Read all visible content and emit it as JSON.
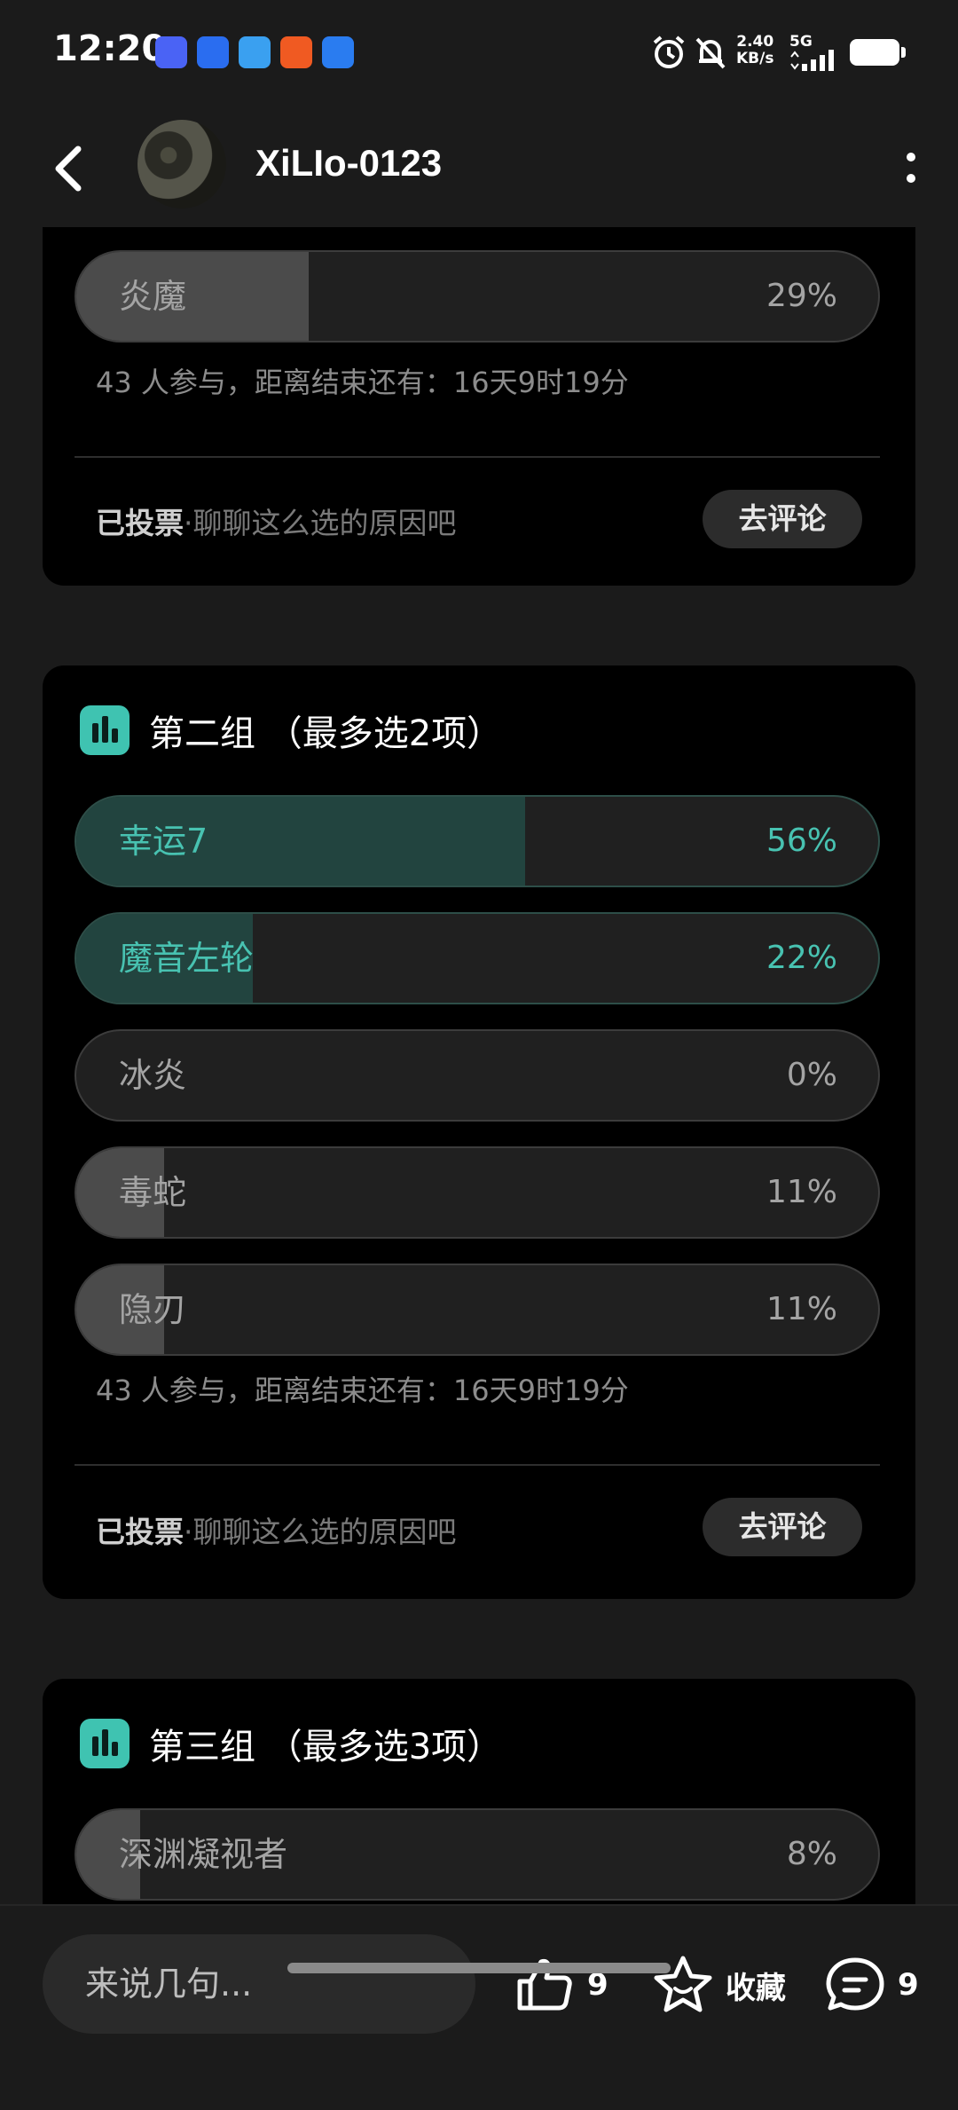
{
  "status_bar": {
    "time": "12:20",
    "net_speed_value": "2.40",
    "net_speed_unit": "KB/s",
    "network": "5G",
    "notif_icons": [
      {
        "name": "vivo-app-icon",
        "color": "#4a63f5"
      },
      {
        "name": "browser-app-icon",
        "color": "#2a6df0"
      },
      {
        "name": "cloud-app-icon",
        "color": "#3aa0f0"
      },
      {
        "name": "taobao-app-icon",
        "color": "#f05a22"
      },
      {
        "name": "message-app-icon",
        "color": "#2a7cf0"
      }
    ]
  },
  "header": {
    "username": "XiLIo-0123"
  },
  "cards": [
    {
      "title": "",
      "options": [
        {
          "label": "炎魔",
          "percent": "29%",
          "fill": 0.29,
          "selected": false
        }
      ],
      "meta": "43 人参与，距离结束还有：16天9时19分",
      "voted_label": "已投票",
      "voted_hint": "·聊聊这么选的原因吧",
      "comment_button": "去评论"
    },
    {
      "title": "第二组 （最多选2项）",
      "options": [
        {
          "label": "幸运7",
          "percent": "56%",
          "fill": 0.56,
          "selected": true
        },
        {
          "label": "魔音左轮",
          "percent": "22%",
          "fill": 0.22,
          "selected": true
        },
        {
          "label": "冰炎",
          "percent": "0%",
          "fill": 0.0,
          "selected": false
        },
        {
          "label": "毒蛇",
          "percent": "11%",
          "fill": 0.11,
          "selected": false
        },
        {
          "label": "隐刃",
          "percent": "11%",
          "fill": 0.11,
          "selected": false
        }
      ],
      "meta": "43 人参与，距离结束还有：16天9时19分",
      "voted_label": "已投票",
      "voted_hint": "·聊聊这么选的原因吧",
      "comment_button": "去评论"
    },
    {
      "title": "第三组 （最多选3项）",
      "options": [
        {
          "label": "深渊凝视者",
          "percent": "8%",
          "fill": 0.08,
          "selected": false
        }
      ]
    }
  ],
  "bottom_bar": {
    "input_placeholder": "来说几句...",
    "like_count": "9",
    "favorite_label": "收藏",
    "comment_count": "9"
  },
  "colors": {
    "accent": "#48c2b1",
    "selected_fill": "#22443f",
    "unselected_fill": "#4b4b4b",
    "background": "#1b1b1b",
    "card_bg": "#000000"
  }
}
